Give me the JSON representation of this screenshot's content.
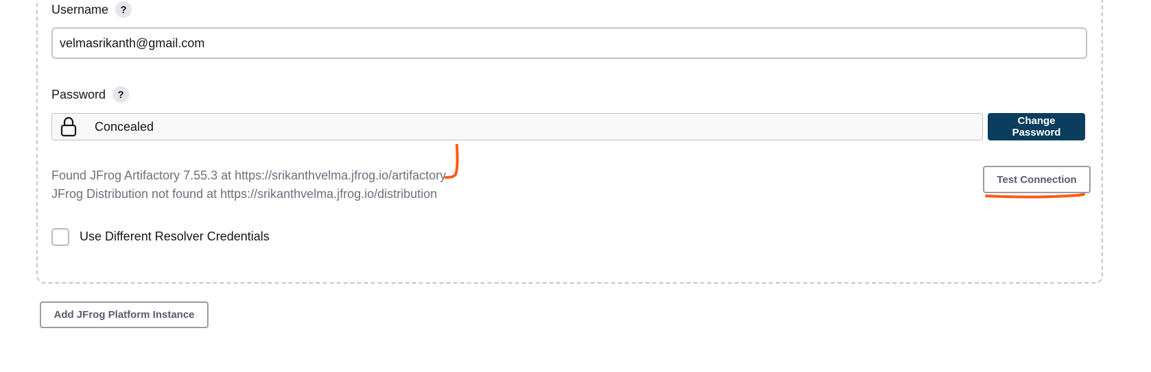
{
  "username": {
    "label": "Username",
    "help": "?",
    "value": "velmasrikanth@gmail.com"
  },
  "password": {
    "label": "Password",
    "help": "?",
    "concealed_text": "Concealed",
    "change_button": "Change Password",
    "icon": "lock-icon"
  },
  "connection": {
    "status_lines": [
      "Found JFrog Artifactory 7.55.3 at https://srikanthvelma.jfrog.io/artifactory",
      "JFrog Distribution not found at https://srikanthvelma.jfrog.io/distribution"
    ],
    "test_button": "Test Connection"
  },
  "resolver": {
    "checkbox_label": "Use Different Resolver Credentials",
    "checked": false
  },
  "add_instance_button": "Add JFrog Platform Instance",
  "colors": {
    "primary_button": "#0b3d5e",
    "annotation_marker": "#ff5a14",
    "status_text": "#6e6e80"
  }
}
